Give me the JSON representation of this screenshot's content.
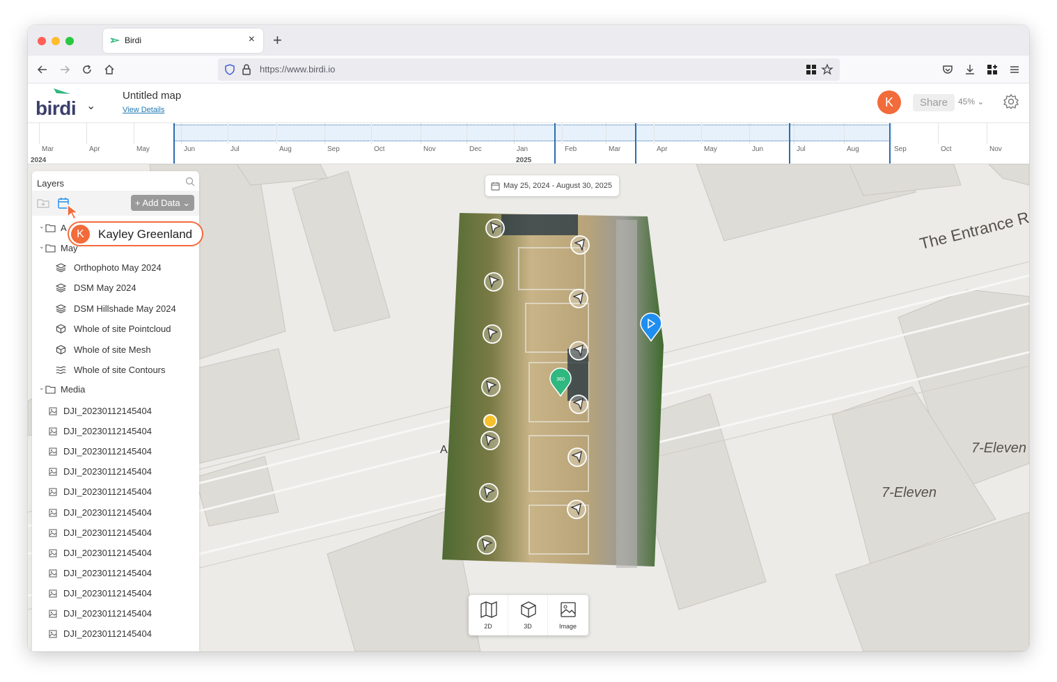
{
  "browser": {
    "tab_title": "Birdi",
    "url": "https://www.birdi.io"
  },
  "app": {
    "logo_text": "birdi",
    "map_title": "Untitled map",
    "view_details": "View Details",
    "avatar_initial": "K",
    "share_label": "Share",
    "zoom_level": "45%"
  },
  "timeline": {
    "months": [
      "Mar",
      "Apr",
      "May",
      "Jun",
      "Jul",
      "Aug",
      "Sep",
      "Oct",
      "Nov",
      "Dec",
      "Jan",
      "Feb",
      "Mar",
      "Apr",
      "May",
      "Jun",
      "Jul",
      "Aug",
      "Sep",
      "Oct",
      "Nov"
    ],
    "years": [
      "2024",
      "2025"
    ]
  },
  "map": {
    "date_range": "May 25, 2024 - August 30, 2025",
    "labels": {
      "road": "The Entrance Rd",
      "store_1": "7-Eleven",
      "store_2": "7-Eleven",
      "letter": "A"
    },
    "view_modes": [
      {
        "label": "2D",
        "icon": "map-icon"
      },
      {
        "label": "3D",
        "icon": "cube-icon"
      },
      {
        "label": "Image",
        "icon": "image-icon"
      }
    ]
  },
  "layers": {
    "title": "Layers",
    "add_data_label": "+ Add Data",
    "folders": [
      {
        "label": "A"
      },
      {
        "label": "May"
      }
    ],
    "items": [
      {
        "label": "Orthophoto May 2024",
        "icon": "layers-icon"
      },
      {
        "label": "DSM May 2024",
        "icon": "layers-icon"
      },
      {
        "label": "DSM Hillshade May 2024",
        "icon": "layers-icon"
      },
      {
        "label": "Whole of site Pointcloud",
        "icon": "cube-icon"
      },
      {
        "label": "Whole of site Mesh",
        "icon": "cube-icon"
      },
      {
        "label": "Whole of site Contours",
        "icon": "contours-icon"
      }
    ],
    "media_folder": "Media",
    "media": [
      "DJI_20230112145404",
      "DJI_20230112145404",
      "DJI_20230112145404",
      "DJI_20230112145404",
      "DJI_20230112145404",
      "DJI_20230112145404",
      "DJI_20230112145404",
      "DJI_20230112145404",
      "DJI_20230112145404",
      "DJI_20230112145404",
      "DJI_20230112145404",
      "DJI_20230112145404"
    ]
  },
  "collaborator": {
    "initial": "K",
    "name": "Kayley Greenland"
  },
  "colors": {
    "accent_orange": "#f26b3a",
    "timeline_blue": "#2b6cb0",
    "pin_blue": "#1f8ef1",
    "pin_green": "#2fb87f",
    "pin_yellow": "#f8c02c"
  }
}
